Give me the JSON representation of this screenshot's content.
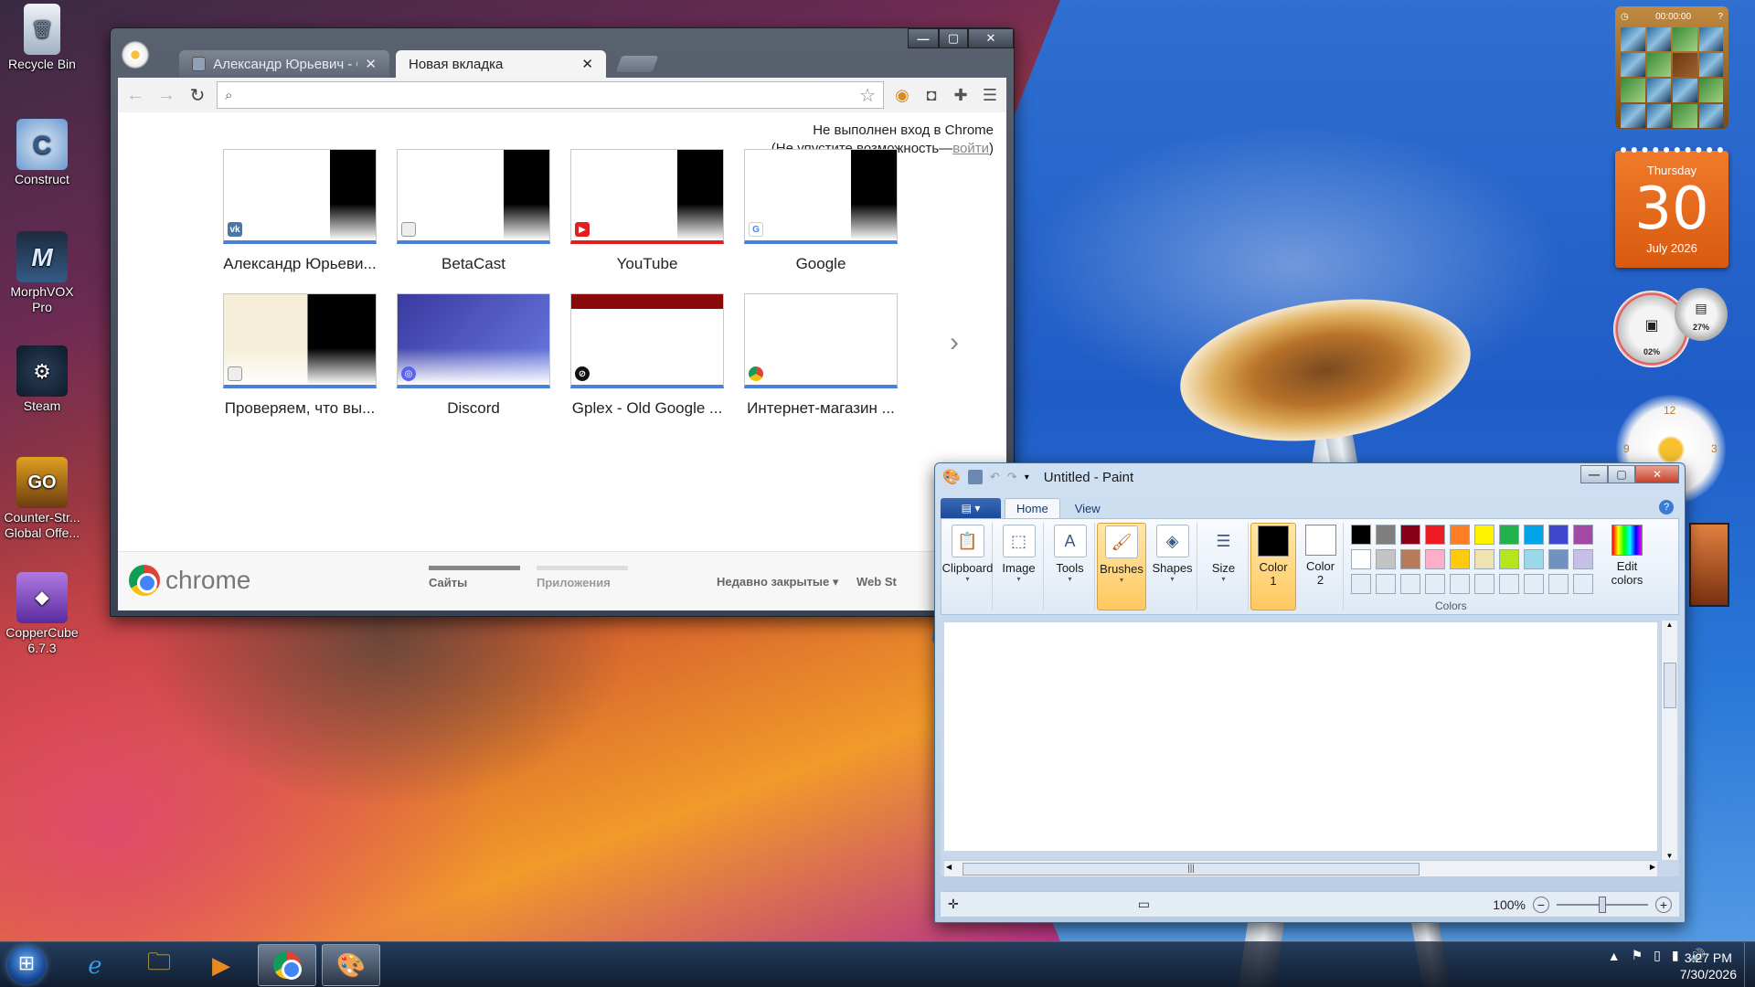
{
  "desktop": {
    "icons": [
      {
        "label": "Recycle Bin",
        "glyph": "🗑"
      },
      {
        "label": "Construct",
        "glyph": "C"
      },
      {
        "label": "MorphVOX Pro",
        "glyph": "M"
      },
      {
        "label": "Steam",
        "glyph": "⚙"
      },
      {
        "label": "Counter-Str... Global Offe...",
        "glyph": "GO"
      },
      {
        "label": "CopperCube 6.7.3",
        "glyph": "◆"
      }
    ]
  },
  "gadgets": {
    "puzzle_timer": "00:00:00",
    "calendar": {
      "weekday": "Thursday",
      "day": "30",
      "month_year": "July 2026"
    },
    "cpu_meter": {
      "cpu": "02%",
      "ram": "27%"
    },
    "clock_numbers": {
      "twelve": "12",
      "nine": "9",
      "three": "3"
    }
  },
  "chrome": {
    "tabs": [
      {
        "title": "Александр Юрьевич - О",
        "active": false
      },
      {
        "title": "Новая вкладка",
        "active": true
      }
    ],
    "window_buttons": {
      "minimize": "—",
      "maximize": "▢",
      "close": "✕"
    },
    "omnibox": {
      "value": "",
      "search_icon": "search-icon"
    },
    "signin": {
      "line1": "Не выполнен вход в Chrome",
      "line2_prefix": "(Не упустите возможность—",
      "line2_link": "войти",
      "line2_suffix": ")"
    },
    "tiles": [
      {
        "label": "Александр Юрьеви...",
        "favicon": "vk-icon"
      },
      {
        "label": "BetaCast",
        "favicon": "page-icon"
      },
      {
        "label": "YouTube",
        "favicon": "youtube-icon"
      },
      {
        "label": "Google",
        "favicon": "google-icon"
      },
      {
        "label": "Проверяем, что вы...",
        "favicon": "page-icon"
      },
      {
        "label": "Discord",
        "favicon": "discord-icon"
      },
      {
        "label": "Gplex - Old Google ...",
        "favicon": "gplex-icon"
      },
      {
        "label": "Интернет-магазин ...",
        "favicon": "chrome-icon"
      }
    ],
    "footer": {
      "brand": "chrome",
      "tab_sites": "Сайты",
      "tab_apps": "Приложения",
      "recently_closed": "Недавно закрытые",
      "web_store": "Web St"
    }
  },
  "paint": {
    "title": "Untitled - Paint",
    "tabs": {
      "home": "Home",
      "view": "View"
    },
    "groups": {
      "clipboard": "Clipboard",
      "image": "Image",
      "tools": "Tools",
      "brushes": "Brushes",
      "shapes": "Shapes",
      "size": "Size",
      "color1": "Color 1",
      "color2": "Color 2",
      "edit_colors": "Edit colors",
      "colors": "Colors"
    },
    "palette": [
      "#000000",
      "#7f7f7f",
      "#880015",
      "#ed1c24",
      "#ff7f27",
      "#fff200",
      "#22b14c",
      "#00a2e8",
      "#3f48cc",
      "#a349a4",
      "#ffffff",
      "#c3c3c3",
      "#b97a57",
      "#ffaec9",
      "#ffc90e",
      "#efe4b0",
      "#b5e61d",
      "#99d9ea",
      "#7092be",
      "#c8bfe7",
      "#e4ecf6",
      "#e4ecf6",
      "#e4ecf6",
      "#e4ecf6",
      "#e4ecf6",
      "#e4ecf6",
      "#e4ecf6",
      "#e4ecf6",
      "#e4ecf6",
      "#e4ecf6"
    ],
    "color1_value": "#000000",
    "color2_value": "#ffffff",
    "zoom": "100%",
    "zoom_level": 0.5
  },
  "taskbar": {
    "apps": [
      "Internet Explorer",
      "Windows Explorer",
      "Media Player",
      "Google Chrome",
      "Paint"
    ],
    "time": "3:27 PM",
    "date": "7/30/2026"
  }
}
